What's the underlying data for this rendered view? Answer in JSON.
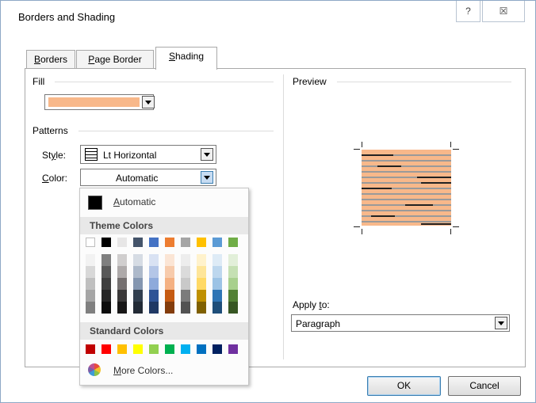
{
  "window": {
    "title": "Borders and Shading",
    "help_glyph": "?",
    "close_glyph": "☒"
  },
  "tabs": [
    {
      "label": "Borders",
      "accel": "B",
      "rest": "orders"
    },
    {
      "label": "Page Border",
      "accel": "P",
      "rest": "age Border"
    },
    {
      "label": "Shading",
      "accel": "S",
      "rest": "hading",
      "active": true
    }
  ],
  "fill": {
    "heading": "Fill",
    "color": "#f8b88a"
  },
  "patterns": {
    "heading": "Patterns",
    "style_label": {
      "pre": "St",
      "accel": "y",
      "post": "le:"
    },
    "style_value": "Lt Horizontal",
    "color_label": {
      "pre": "",
      "accel": "C",
      "post": "olor:"
    },
    "color_value": "Automatic"
  },
  "color_popup": {
    "automatic_accel": "A",
    "automatic_rest": "utomatic",
    "theme_heading": "Theme Colors",
    "standard_heading": "Standard Colors",
    "more_accel": "M",
    "more_rest": "ore Colors...",
    "theme_colors": [
      [
        "#ffffff",
        "#000000",
        "#e7e6e6",
        "#44546a",
        "#4472c4",
        "#ed7d31",
        "#a5a5a5",
        "#ffc000",
        "#5b9bd5",
        "#70ad47"
      ],
      [
        "#f2f2f2",
        "#7f7f7f",
        "#d0cece",
        "#d6dce4",
        "#d9e2f3",
        "#fbe5d5",
        "#ededed",
        "#fff2cc",
        "#deebf6",
        "#e2efd9"
      ],
      [
        "#d8d8d8",
        "#595959",
        "#aeaaaa",
        "#adb9ca",
        "#b4c6e7",
        "#f7cbac",
        "#dbdbdb",
        "#fee599",
        "#bdd7ee",
        "#c5e0b3"
      ],
      [
        "#bfbfbf",
        "#3f3f3f",
        "#757070",
        "#8496b0",
        "#8eaadb",
        "#f4b183",
        "#c9c9c9",
        "#ffd965",
        "#9cc3e5",
        "#a8d08d"
      ],
      [
        "#a5a5a5",
        "#262626",
        "#3a3838",
        "#323f4f",
        "#2f5496",
        "#c55a11",
        "#7b7b7b",
        "#bf9000",
        "#2e75b5",
        "#538135"
      ],
      [
        "#7f7f7f",
        "#0c0c0c",
        "#171616",
        "#222a35",
        "#1f3864",
        "#833c0b",
        "#525252",
        "#7f6000",
        "#1e4e79",
        "#375623"
      ]
    ],
    "standard_colors": [
      "#c00000",
      "#ff0000",
      "#ffc000",
      "#ffff00",
      "#92d050",
      "#00b050",
      "#00b0f0",
      "#0070c0",
      "#002060",
      "#7030a0"
    ]
  },
  "preview": {
    "heading": "Preview",
    "apply_label": {
      "pre": "Apply ",
      "accel": "t",
      "post": "o:"
    },
    "apply_value": "Paragraph"
  },
  "buttons": {
    "ok": "OK",
    "cancel": "Cancel"
  }
}
